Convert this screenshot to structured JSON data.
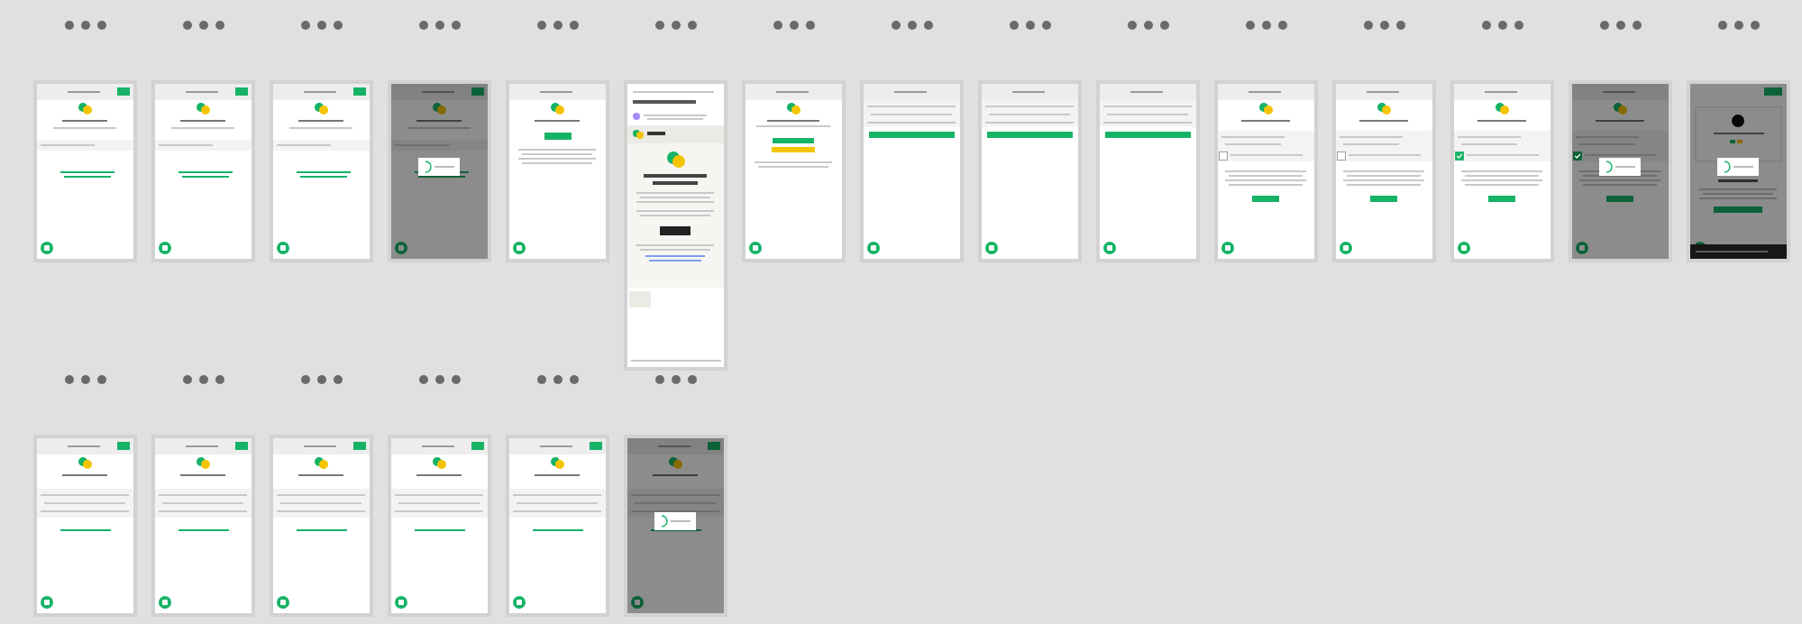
{
  "rows": [
    {
      "screens": [
        {
          "kind": "signup",
          "dimmed": false
        },
        {
          "kind": "signup",
          "dimmed": false
        },
        {
          "kind": "signup",
          "dimmed": false
        },
        {
          "kind": "signup",
          "dimmed": true
        },
        {
          "kind": "check-email",
          "dimmed": false
        },
        {
          "kind": "email",
          "dimmed": false
        },
        {
          "kind": "verify-prompt",
          "dimmed": false
        },
        {
          "kind": "form",
          "dimmed": false
        },
        {
          "kind": "form",
          "dimmed": false
        },
        {
          "kind": "form",
          "dimmed": false
        },
        {
          "kind": "terms",
          "dimmed": false,
          "checked": false
        },
        {
          "kind": "terms",
          "dimmed": false,
          "checked": false
        },
        {
          "kind": "terms",
          "dimmed": false,
          "checked": true
        },
        {
          "kind": "terms",
          "dimmed": true,
          "checked": true
        },
        {
          "kind": "article",
          "dimmed": true
        }
      ]
    },
    {
      "screens": [
        {
          "kind": "login",
          "dimmed": false
        },
        {
          "kind": "login",
          "dimmed": false
        },
        {
          "kind": "login",
          "dimmed": false
        },
        {
          "kind": "login",
          "dimmed": false
        },
        {
          "kind": "login",
          "dimmed": false
        },
        {
          "kind": "login",
          "dimmed": true
        }
      ]
    }
  ]
}
